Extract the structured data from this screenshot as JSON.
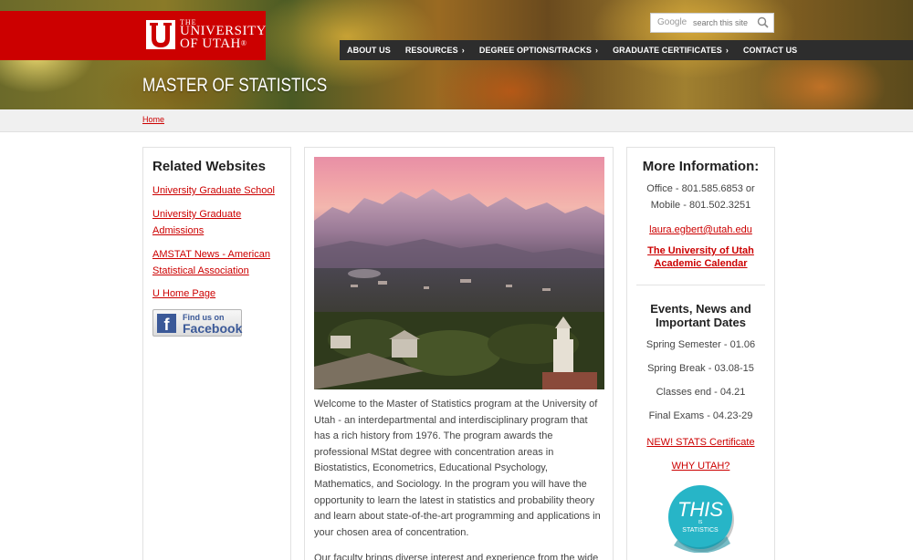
{
  "header": {
    "logo_small": "THE",
    "logo_line1": "UNIVERSITY",
    "logo_line2": "OF UTAH",
    "page_title": "MASTER OF STATISTICS",
    "search": {
      "brand": "Google",
      "placeholder": "search this site",
      "icon": "search-icon"
    },
    "nav": [
      {
        "label": "ABOUT US",
        "chevron": ""
      },
      {
        "label": "RESOURCES",
        "chevron": "›"
      },
      {
        "label": "DEGREE OPTIONS/TRACKS",
        "chevron": "›"
      },
      {
        "label": "GRADUATE CERTIFICATES",
        "chevron": "›"
      },
      {
        "label": "CONTACT US",
        "chevron": ""
      }
    ]
  },
  "breadcrumb": {
    "home": "Home"
  },
  "left": {
    "heading": "Related Websites",
    "links": [
      "University Graduate School",
      "University Graduate Admissions",
      "AMSTAT News - American Statistical Association",
      "U Home Page"
    ],
    "facebook": {
      "find": "Find us on",
      "name": "Facebook"
    }
  },
  "main": {
    "intro": "Welcome to the Master of Statistics program at the University of Utah - an interdepartmental and interdisciplinary program that has a rich history from 1976. The program awards the professional MStat degree with concentration areas in Biostatistics, Econometrics, Educational Psychology, Mathematics, and Sociology. In the program you will have the opportunity to learn the latest in statistics and probability theory and learn about state-of-the-art programming and applications in your chosen area of concentration.",
    "second": "Our faculty brings diverse interest and experience from the wide"
  },
  "right": {
    "heading": "More Information:",
    "office": "Office - 801.585.6853 or Mobile - 801.502.3251",
    "email": "laura.egbert@utah.edu",
    "calendar": "The University of Utah Academic Calendar",
    "events_heading": "Events, News and Important Dates",
    "events": [
      "Spring Semester - 01.06",
      "Spring Break - 03.08-15",
      "Classes end - 04.21",
      "Final Exams - 04.23-29"
    ],
    "cert_link": "NEW! STATS Certificate",
    "why_link": "WHY UTAH?",
    "badge": {
      "big": "THIS",
      "small": "IS",
      "bottom": "STATISTICS"
    }
  },
  "colors": {
    "utah_red": "#cc0000",
    "nav_bg": "#2d2d2d"
  }
}
